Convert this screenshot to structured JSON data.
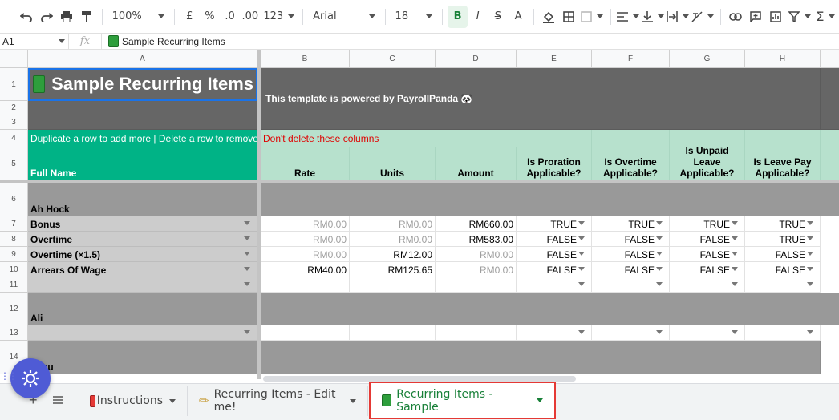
{
  "toolbar": {
    "zoom": "100%",
    "currency": "£",
    "percent": "%",
    "dec_less": ".0",
    "dec_more": ".00",
    "format": "123",
    "font": "Arial",
    "font_size": "18"
  },
  "formula_bar": {
    "cell_ref": "A1",
    "fx": "fx",
    "content": "Sample Recurring Items"
  },
  "columns": [
    "A",
    "B",
    "C",
    "D",
    "E",
    "F",
    "G",
    "H"
  ],
  "rows": [
    "1",
    "2",
    "3",
    "4",
    "5",
    "6",
    "7",
    "8",
    "9",
    "10",
    "11",
    "12",
    "13",
    "14"
  ],
  "sheet": {
    "title": "Sample Recurring Items",
    "powered_by": "This template is powered by PayrollPanda 🐼",
    "instruction": "Duplicate a row to add more | Delete a row to remove",
    "warning": "Don't delete these columns",
    "headers": {
      "full_name": "Full Name",
      "rate": "Rate",
      "units": "Units",
      "amount": "Amount",
      "proration": "Is Proration Applicable?",
      "overtime": "Is Overtime Applicable?",
      "unpaid_leave": "Is Unpaid Leave Applicable?",
      "leave_pay": "Is Leave Pay Applicable?"
    },
    "employees": [
      "Ah Hock",
      "Ali",
      "...thu"
    ],
    "items": [
      {
        "name": "Bonus",
        "rate": "RM0.00",
        "units": "RM0.00",
        "amount": "RM660.00",
        "e": "TRUE",
        "f": "TRUE",
        "g": "TRUE",
        "h": "TRUE"
      },
      {
        "name": "Overtime",
        "rate": "RM0.00",
        "units": "RM0.00",
        "amount": "RM583.00",
        "e": "FALSE",
        "f": "FALSE",
        "g": "FALSE",
        "h": "TRUE"
      },
      {
        "name": "Overtime (×1.5)",
        "rate": "RM0.00",
        "units": "RM12.00",
        "amount": "RM0.00",
        "e": "FALSE",
        "f": "FALSE",
        "g": "FALSE",
        "h": "FALSE"
      },
      {
        "name": "Arrears Of Wage",
        "rate": "RM40.00",
        "units": "RM125.65",
        "amount": "RM0.00",
        "e": "FALSE",
        "f": "FALSE",
        "g": "FALSE",
        "h": "FALSE"
      }
    ]
  },
  "tabs": [
    {
      "label": "Instructions"
    },
    {
      "label": "Recurring Items - Edit me!"
    },
    {
      "label": "Recurring Items - Sample"
    }
  ],
  "colors": {
    "green": "#00b386",
    "mint": "#b7e1cd",
    "dark": "#666666",
    "active_tab": "#188038",
    "highlight": "#e53935"
  }
}
